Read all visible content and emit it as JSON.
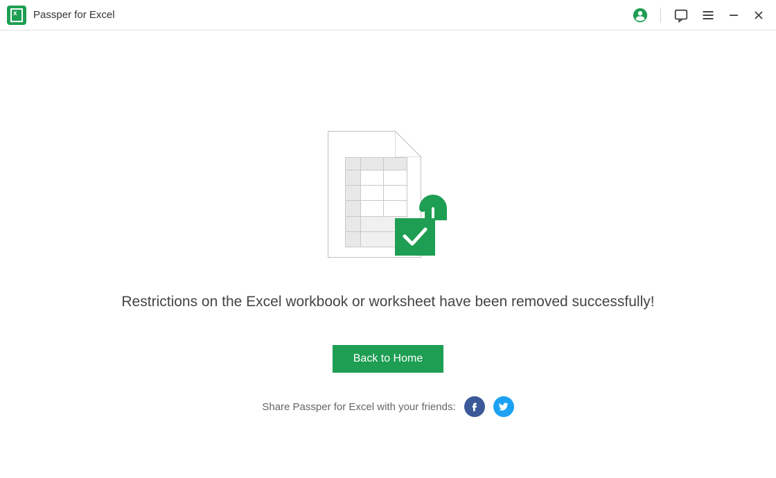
{
  "app": {
    "title": "Passper for Excel"
  },
  "main": {
    "success_message": "Restrictions on the Excel workbook or worksheet have been removed successfully!",
    "back_button_label": "Back to Home",
    "share_label": "Share Passper for Excel with your friends:"
  },
  "colors": {
    "brand": "#1e9e53",
    "facebook": "#3b5998",
    "twitter": "#1da1f2"
  }
}
